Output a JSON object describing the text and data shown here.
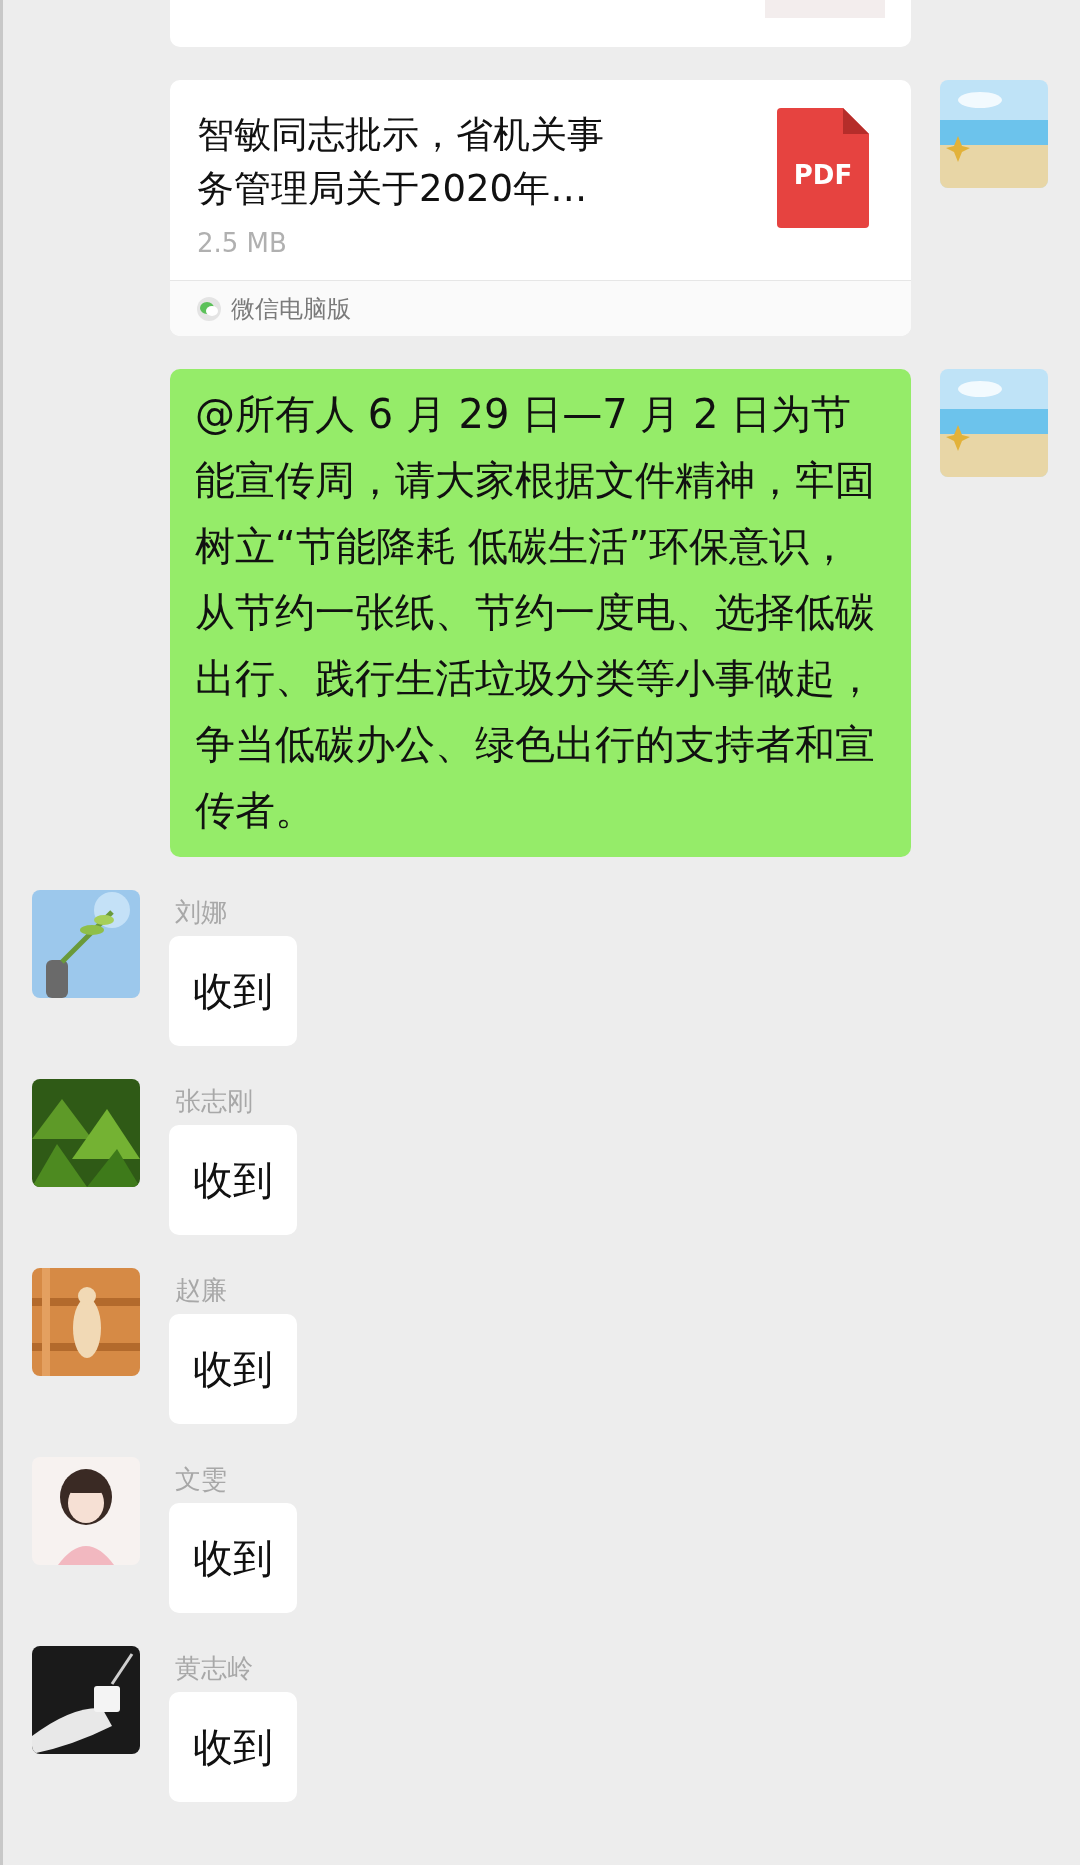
{
  "messages": [
    {
      "kind": "partial"
    },
    {
      "kind": "file",
      "title": "智敏同志批示，省机关事务管理局关于2020年…",
      "file_type": "PDF",
      "size": "2.5 MB",
      "source": "微信电脑版"
    },
    {
      "kind": "text",
      "outgoing": true,
      "text": "@所有人 6 月 29 日—7 月 2 日为节能宣传周，请大家根据文件精神，牢固树立“节能降耗 低碳生活”环保意识，从节约一张纸、节约一度电、选择低碳出行、践行生活垃圾分类等小事做起，争当低碳办公、绿色出行的支持者和宣传者。"
    },
    {
      "kind": "text",
      "outgoing": false,
      "sender": "刘娜",
      "text": "收到"
    },
    {
      "kind": "text",
      "outgoing": false,
      "sender": "张志刚",
      "text": "收到"
    },
    {
      "kind": "text",
      "outgoing": false,
      "sender": "赵廉",
      "text": "收到"
    },
    {
      "kind": "text",
      "outgoing": false,
      "sender": "文雯",
      "text": "收到"
    },
    {
      "kind": "text",
      "outgoing": false,
      "sender": "黄志岭",
      "text": "收到"
    }
  ]
}
